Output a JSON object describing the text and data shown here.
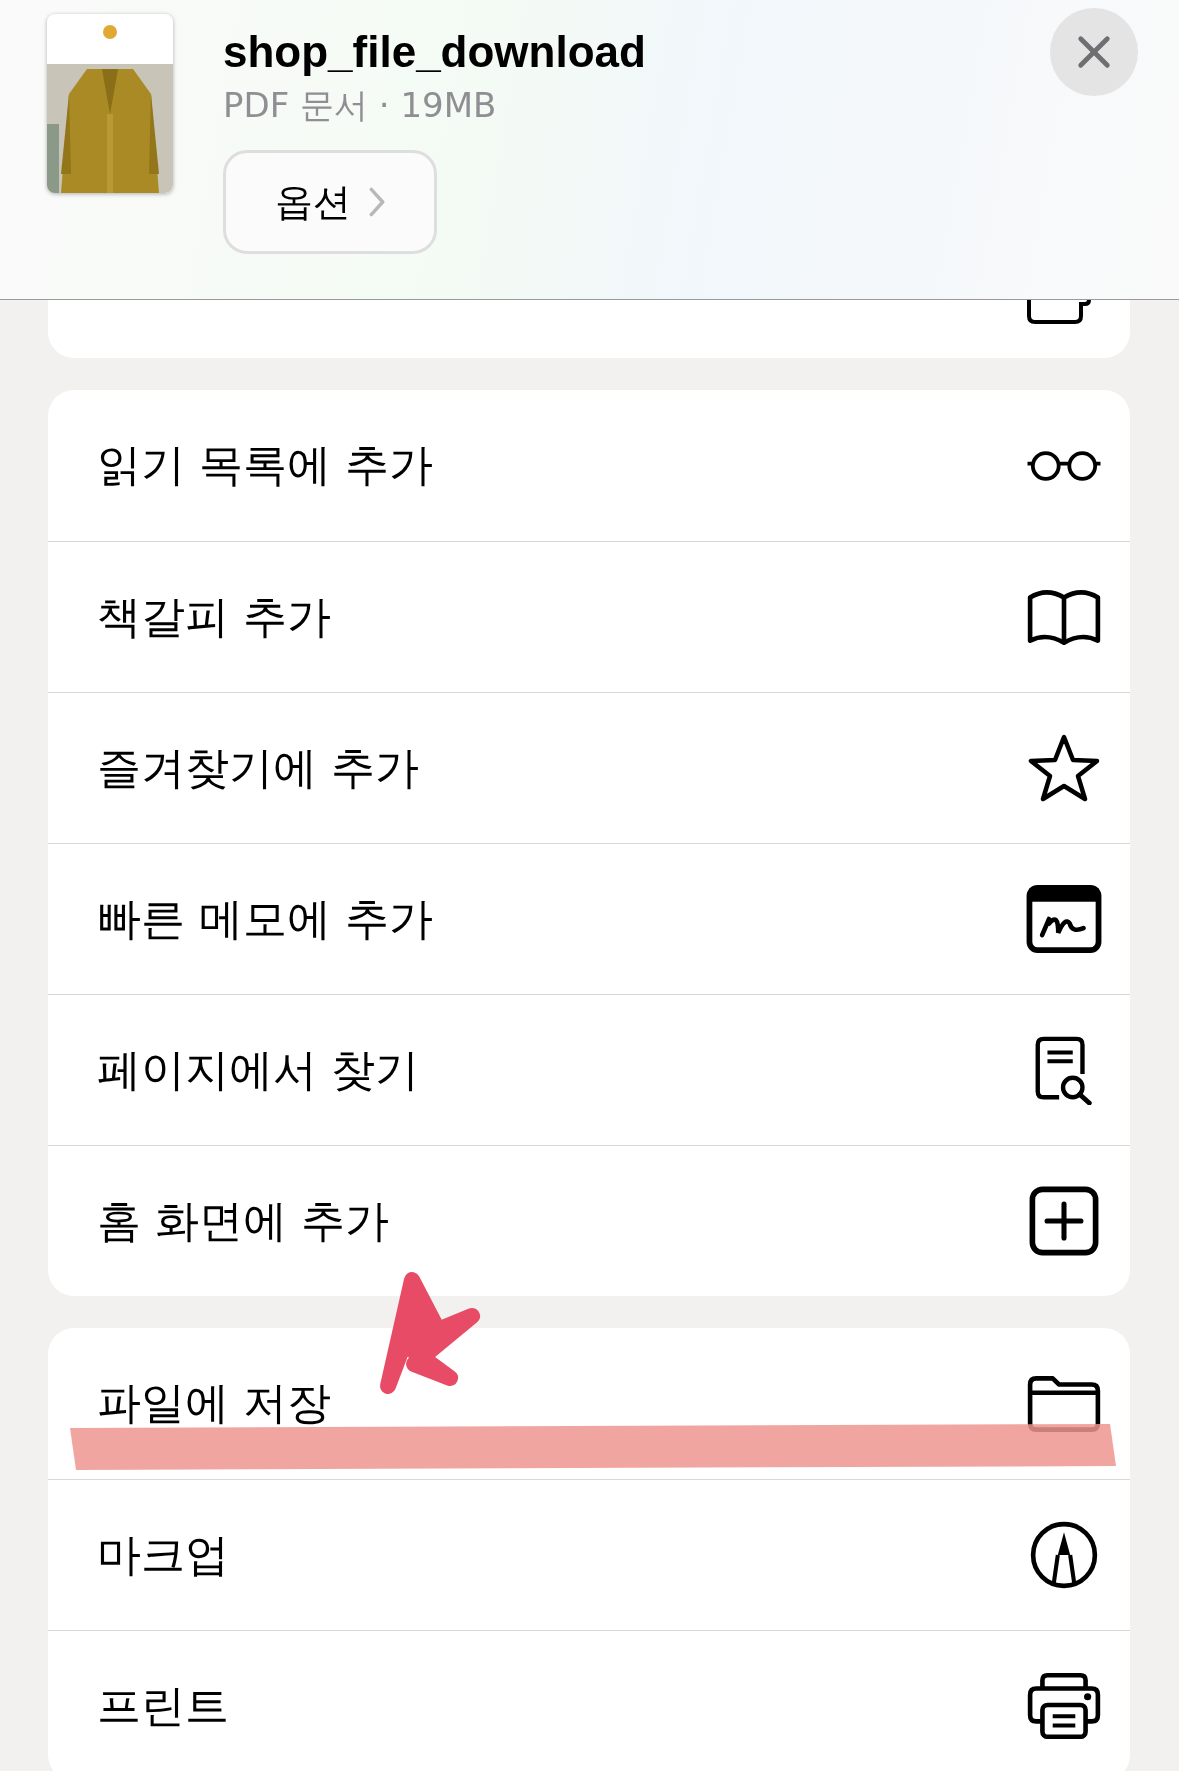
{
  "header": {
    "file_name": "shop_file_download",
    "file_info": "PDF 문서 · 19MB",
    "options_button": "옵션"
  },
  "sections": [
    {
      "items": [
        {
          "kind": "cropped"
        }
      ]
    },
    {
      "items": [
        {
          "label": "읽기 목록에 추가",
          "kind": "glasses"
        },
        {
          "label": "책갈피 추가",
          "kind": "book"
        },
        {
          "label": "즐겨찾기에 추가",
          "kind": "star"
        },
        {
          "label": "빠른 메모에 추가",
          "kind": "memo"
        },
        {
          "label": "페이지에서 찾기",
          "kind": "find"
        },
        {
          "label": "홈 화면에 추가",
          "kind": "plus-square"
        }
      ]
    },
    {
      "items": [
        {
          "label": "파일에 저장",
          "kind": "folder"
        },
        {
          "label": "마크업",
          "kind": "markup"
        },
        {
          "label": "프린트",
          "kind": "printer"
        }
      ]
    }
  ]
}
